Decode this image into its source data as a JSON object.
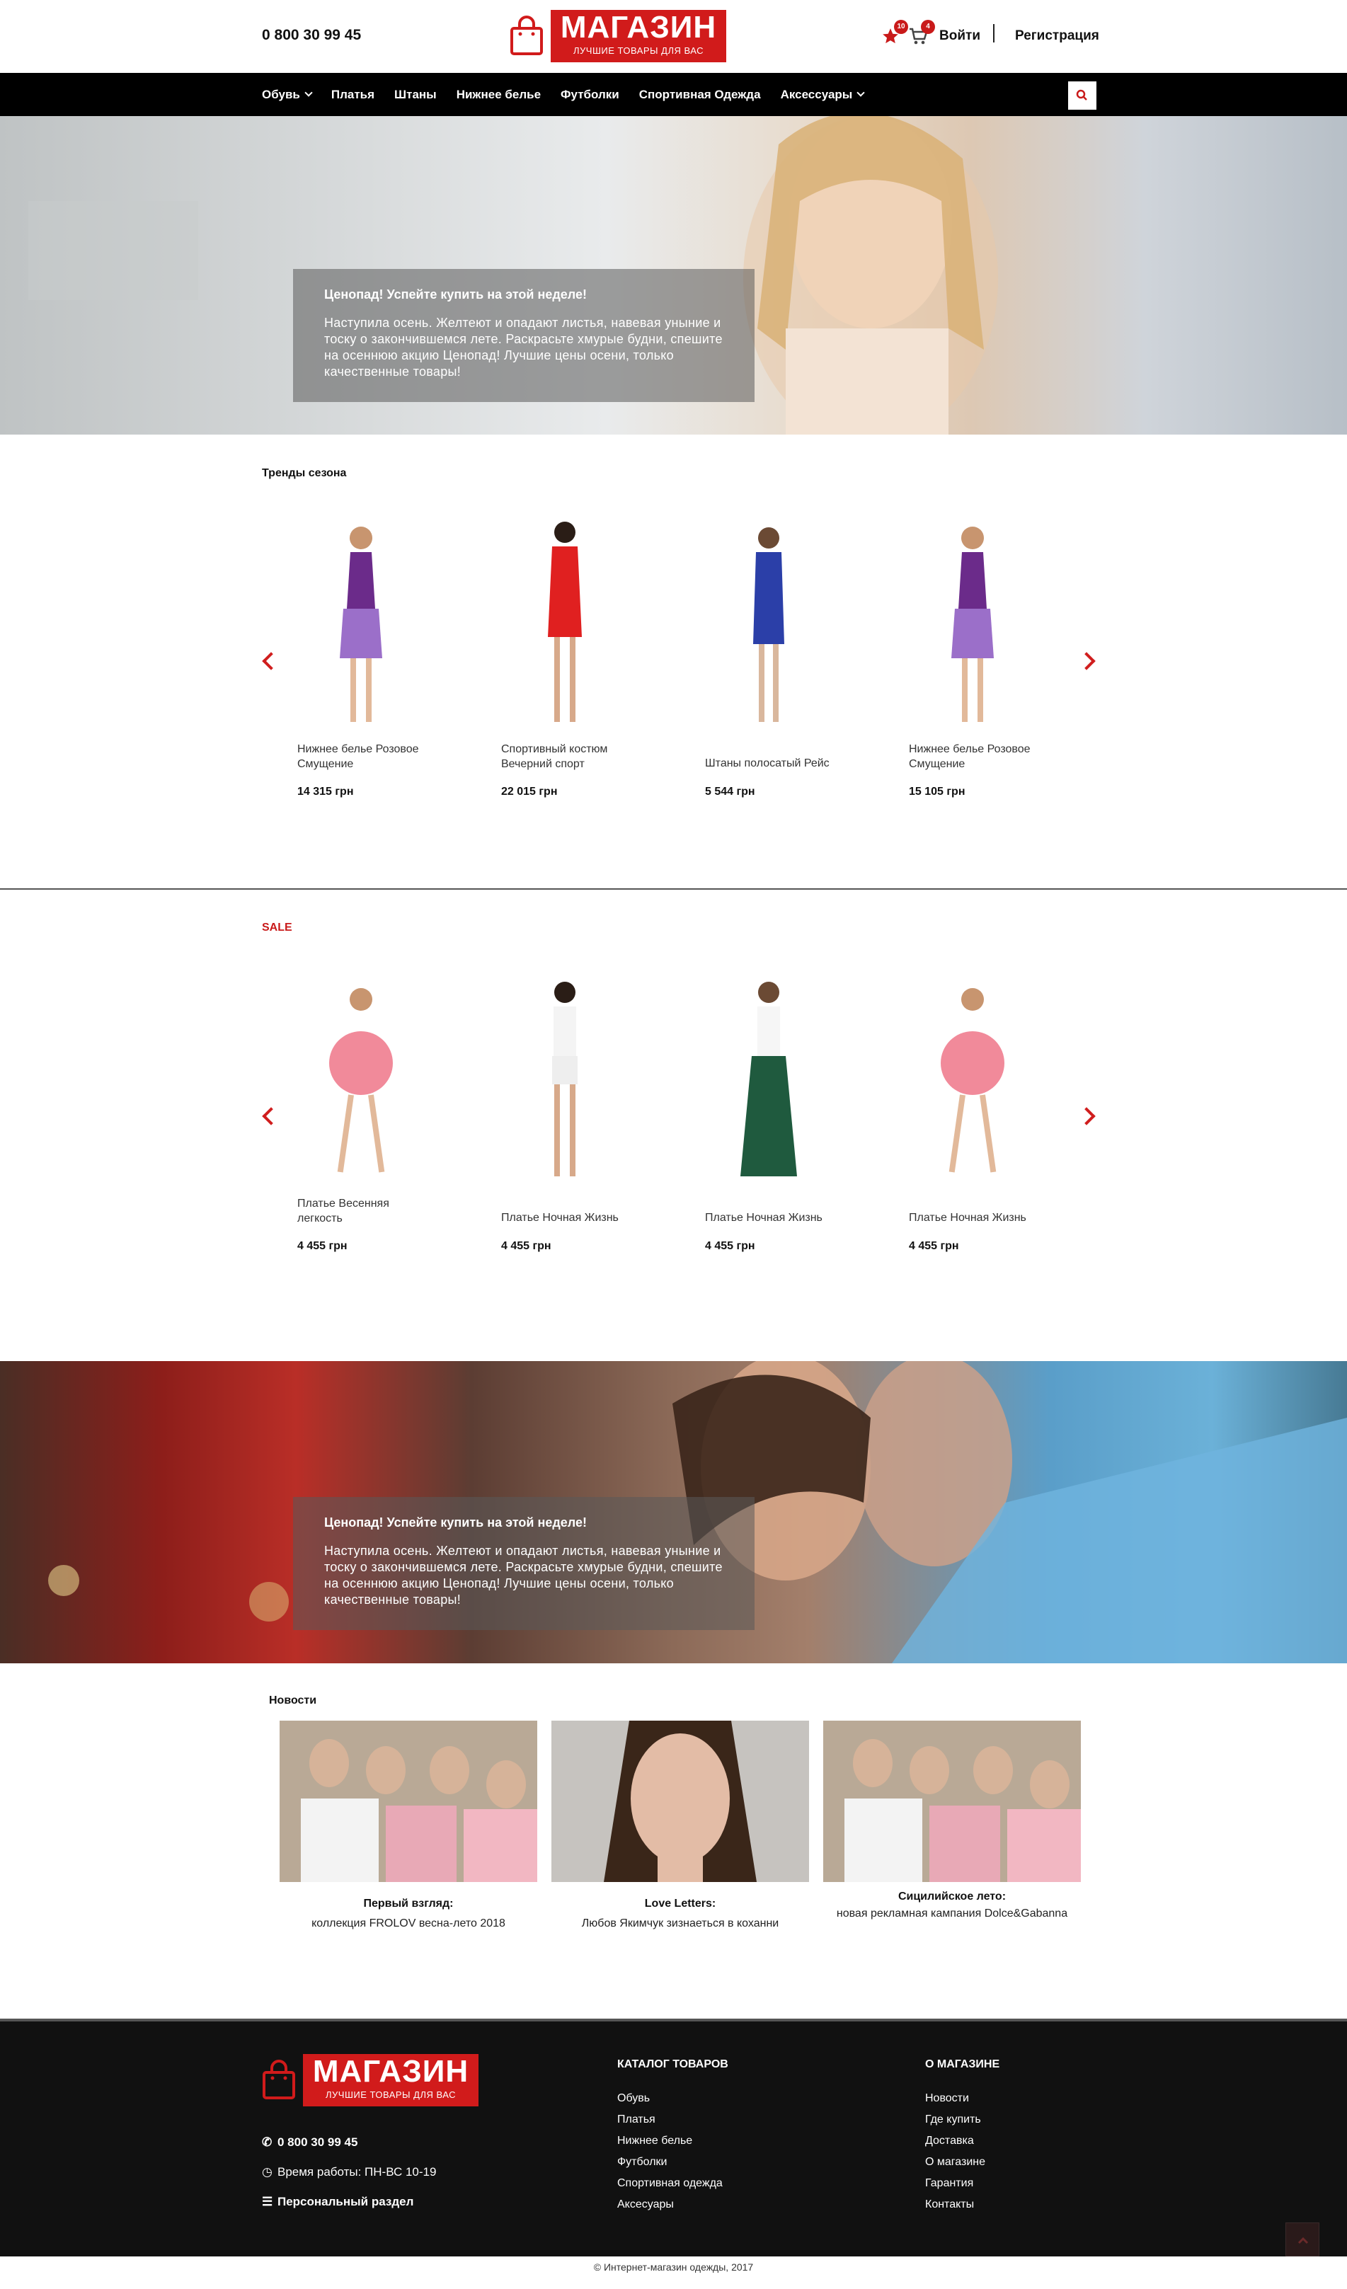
{
  "header": {
    "phone": "0 800 30 99 45",
    "logo_title": "МАГАЗИН",
    "logo_subtitle": "ЛУЧШИЕ ТОВАРЫ ДЛЯ ВАС",
    "favorites_count": "10",
    "cart_count": "4",
    "login": "Войти",
    "register": "Регистрация"
  },
  "nav": {
    "items": [
      {
        "label": "Обувь",
        "dropdown": true
      },
      {
        "label": "Платья",
        "dropdown": false
      },
      {
        "label": "Штаны",
        "dropdown": false
      },
      {
        "label": "Нижнее белье",
        "dropdown": false
      },
      {
        "label": "Футболки",
        "dropdown": false
      },
      {
        "label": "Спортивная Одежда",
        "dropdown": false
      },
      {
        "label": "Аксессуары",
        "dropdown": true
      }
    ],
    "search_icon": "search-icon"
  },
  "hero1": {
    "title": "Ценопад! Успейте купить на этой неделе!",
    "text": "Наступила осень. Желтеют и опадают листья, навевая уныние и тоску о закончившемся лете. Раскрасьте хмурые будни, спешите на осеннюю акцию Ценопад! Лучшие цены осени, только качественные товары!"
  },
  "trends": {
    "title": "Тренды сезона",
    "products": [
      {
        "name": "Нижнее белье Розовое Смущение",
        "price": "14 315 грн"
      },
      {
        "name": "Спортивный костюм Вечерний спорт",
        "price": "22 015 грн"
      },
      {
        "name": "Штаны полосатый Рейс",
        "price": "5 544 грн"
      },
      {
        "name": "Нижнее белье Розовое Смущение",
        "price": "15 105 грн"
      }
    ]
  },
  "sale": {
    "title": "SALE",
    "products": [
      {
        "name": "Платье Весенняя легкость",
        "price": "4 455 грн"
      },
      {
        "name": "Платье Ночная Жизнь",
        "price": "4 455 грн"
      },
      {
        "name": "Платье Ночная Жизнь",
        "price": "4 455 грн"
      },
      {
        "name": "Платье Ночная Жизнь",
        "price": "4 455 грн"
      }
    ]
  },
  "hero2": {
    "title": "Ценопад! Успейте купить на этой неделе!",
    "text": "Наступила осень. Желтеют и опадают листья, навевая уныние и тоску о закончившемся лете. Раскрасьте хмурые будни, спешите на осеннюю акцию Ценопад! Лучшие цены осени, только качественные товары!"
  },
  "news": {
    "title": "Новости",
    "items": [
      {
        "title": "Первый взгляд:",
        "text": "коллекция FROLOV весна-лето 2018"
      },
      {
        "title": "Love Letters:",
        "text": "Любов Якимчук зизнаеться в коханни"
      },
      {
        "title": "Сицилийское лето:",
        "text": "новая рекламная кампания Dolce&Gabanna"
      }
    ]
  },
  "footer": {
    "logo_title": "МАГАЗИН",
    "logo_subtitle": "ЛУЧШИЕ ТОВАРЫ ДЛЯ ВАС",
    "phone": "0 800 30 99 45",
    "hours": "Время работы: ПН-ВС 10-19",
    "personal": "Персональный раздел",
    "catalog_title": "КАТАЛОГ ТОВАРОВ",
    "catalog_links": [
      "Обувь",
      "Платья",
      "Нижнее белье",
      "Футболки",
      "Спортивная одежда",
      "Аксесуары"
    ],
    "about_title": "О МАГАЗИНЕ",
    "about_links": [
      "Новости",
      "Где купить",
      "Доставка",
      "О магазине",
      "Гарантия",
      "Контакты"
    ],
    "copyright": "© Интернет-магазин одежды, 2017"
  },
  "colors": {
    "accent": "#d11b1b",
    "nav_bg": "#000000",
    "footer_bg": "#111111"
  }
}
